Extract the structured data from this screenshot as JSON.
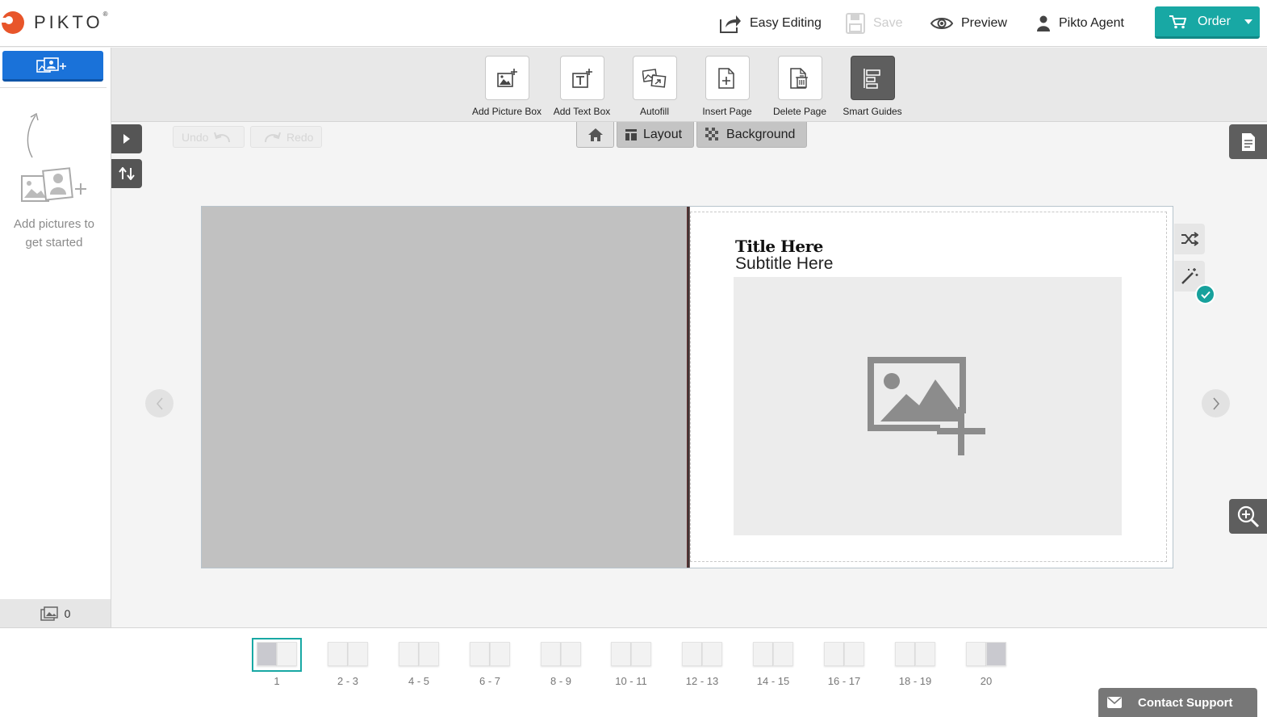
{
  "app": {
    "brand": "PIKTO",
    "trademark": "®"
  },
  "header": {
    "easy_editing": "Easy Editing",
    "save": "Save",
    "preview": "Preview",
    "user": "Pikto Agent",
    "order": "Order"
  },
  "sidebar": {
    "hint": "Add pictures to get started",
    "photo_count": "0"
  },
  "toolbar": {
    "tools": [
      {
        "label": "Add Picture Box",
        "icon": "add-picture-box-icon"
      },
      {
        "label": "Add Text Box",
        "icon": "add-text-box-icon"
      },
      {
        "label": "Autofill",
        "icon": "autofill-icon"
      },
      {
        "label": "Insert Page",
        "icon": "insert-page-icon"
      },
      {
        "label": "Delete Page",
        "icon": "delete-page-icon"
      },
      {
        "label": "Smart Guides",
        "icon": "smart-guides-icon",
        "active": true
      }
    ]
  },
  "canvas": {
    "undo": "Undo",
    "redo": "Redo",
    "tabs": {
      "layout": "Layout",
      "background": "Background"
    },
    "page": {
      "title": "Title Here",
      "subtitle": "Subtitle Here"
    }
  },
  "pages": [
    {
      "label": "1",
      "active": true
    },
    {
      "label": "2 - 3"
    },
    {
      "label": "4 - 5"
    },
    {
      "label": "6 - 7"
    },
    {
      "label": "8 - 9"
    },
    {
      "label": "10 - 11"
    },
    {
      "label": "12 - 13"
    },
    {
      "label": "14 - 15"
    },
    {
      "label": "16 - 17"
    },
    {
      "label": "18 - 19"
    },
    {
      "label": "20"
    }
  ],
  "support": {
    "label": "Contact Support"
  },
  "colors": {
    "accent": "#18a8a4",
    "primary": "#1a72d9",
    "toolbar": "#e8e8e8"
  }
}
